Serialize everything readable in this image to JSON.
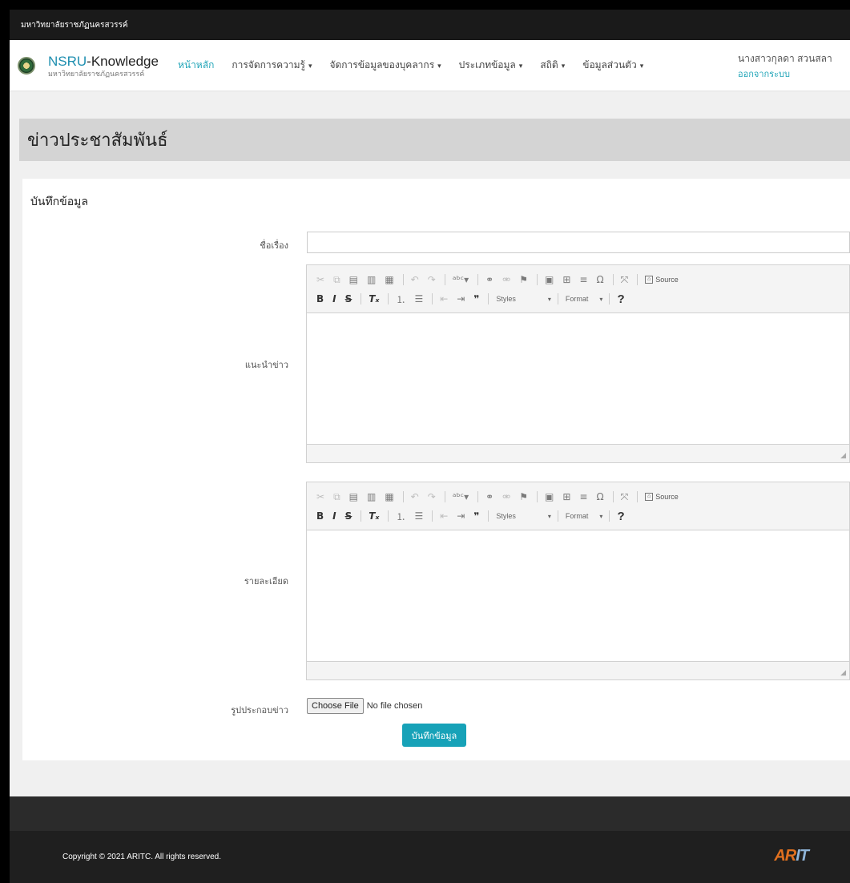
{
  "topbar": {
    "text": "มหาวิทยาลัยราชภัฏนครสวรรค์"
  },
  "brand": {
    "name_prefix": "NSRU",
    "name_suffix": "-Knowledge",
    "subtitle": "มหาวิทยาลัยราชภัฏนครสวรรค์"
  },
  "nav": {
    "items": [
      {
        "label": "หน้าหลัก",
        "dropdown": false,
        "active": true
      },
      {
        "label": "การจัดการความรู้",
        "dropdown": true
      },
      {
        "label": "จัดการข้อมูลของบุคลากร",
        "dropdown": true
      },
      {
        "label": "ประเภทข้อมูล",
        "dropdown": true
      },
      {
        "label": "สถิติ",
        "dropdown": true
      },
      {
        "label": "ข้อมูลส่วนตัว",
        "dropdown": true
      }
    ],
    "caret": "▾"
  },
  "user": {
    "name": "นางสาวกุลดา สวนสลา",
    "logout": "ออกจากระบบ"
  },
  "page": {
    "title": "ข่าวประชาสัมพันธ์"
  },
  "form": {
    "title": "บันทึกข้อมูล",
    "subject_label": "ชื่อเรื่อง",
    "subject_value": "",
    "intro_label": "แนะนำข่าว",
    "detail_label": "รายละเอียด",
    "image_label": "รูปประกอบข่าว",
    "file_button": "Choose File",
    "file_status": "No file chosen",
    "submit": "บันทึกข้อมูล"
  },
  "editor": {
    "source": "Source",
    "styles": "Styles",
    "format": "Format",
    "help": "?"
  },
  "footer": {
    "copyright": "Copyright © 2021 ARITC. All rights reserved.",
    "logo_a": "AR",
    "logo_b": "IT"
  }
}
